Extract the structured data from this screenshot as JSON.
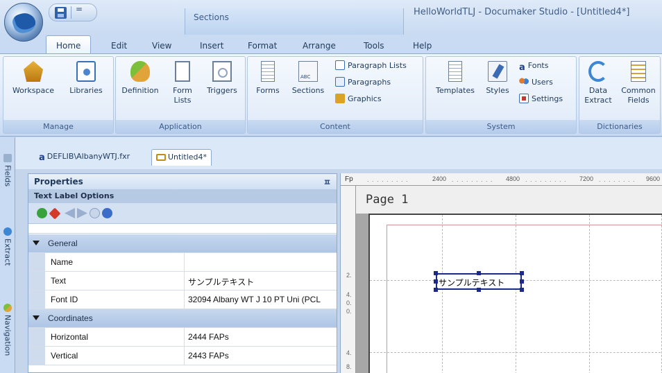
{
  "window": {
    "title": "HelloWorldTLJ - Documaker Studio - [Untitled4*]",
    "context_tab": "Sections",
    "qat_dropdown": "="
  },
  "tabs": [
    "Home",
    "Edit",
    "View",
    "Insert",
    "Format",
    "Arrange",
    "Tools",
    "Help"
  ],
  "ribbon": {
    "manage": {
      "label": "Manage",
      "workspace": "Workspace",
      "libraries": "Libraries"
    },
    "application": {
      "label": "Application",
      "definition": "Definition",
      "form_lists_1": "Form",
      "form_lists_2": "Lists",
      "triggers": "Triggers"
    },
    "content": {
      "label": "Content",
      "forms": "Forms",
      "sections": "Sections",
      "paragraph_lists": "Paragraph Lists",
      "paragraphs": "Paragraphs",
      "graphics": "Graphics"
    },
    "system": {
      "label": "System",
      "templates": "Templates",
      "styles": "Styles",
      "fonts": "Fonts",
      "fonts_glyph": "a",
      "users": "Users",
      "settings": "Settings"
    },
    "dictionaries": {
      "label": "Dictionaries",
      "data_extract_1": "Data",
      "data_extract_2": "Extract",
      "common_fields_1": "Common",
      "common_fields_2": "Fields"
    }
  },
  "side_tabs": [
    "Fields",
    "Extract",
    "Navigation"
  ],
  "doc_tabs": [
    {
      "label": "DEFLIB\\AlbanyWTJ.fxr",
      "glyph": "a"
    },
    {
      "label": "Untitled4*"
    }
  ],
  "properties": {
    "title": "Properties",
    "pin": "ㅍ",
    "subtitle": "Text Label Options",
    "rows": [
      {
        "name": "General",
        "category": true
      },
      {
        "name": "Name",
        "value": ""
      },
      {
        "name": "Text",
        "value": "サンプルテキスト"
      },
      {
        "name": "Font ID",
        "value": "32094 Albany WT J 10 PT Uni (PCL"
      },
      {
        "name": "Coordinates",
        "category": true
      },
      {
        "name": "Horizontal",
        "value": "2444 FAPs"
      },
      {
        "name": "Vertical",
        "value": "2443 FAPs"
      }
    ]
  },
  "canvas": {
    "ruler_prefix": "Fp",
    "ruler_ticks": [
      "2400",
      "4800",
      "7200",
      "9600"
    ],
    "ruler_left_labels": [
      "2.",
      "4.",
      "0.",
      "0.",
      "4.",
      "8."
    ],
    "page_label": "Page 1",
    "text_label": "サンプルテキスト"
  },
  "colors": {
    "ribbon_bg": "#dbe8f8",
    "accent_text": "#1e395b",
    "selection": "#1b2a8a",
    "margin_line": "#d78f8f"
  }
}
